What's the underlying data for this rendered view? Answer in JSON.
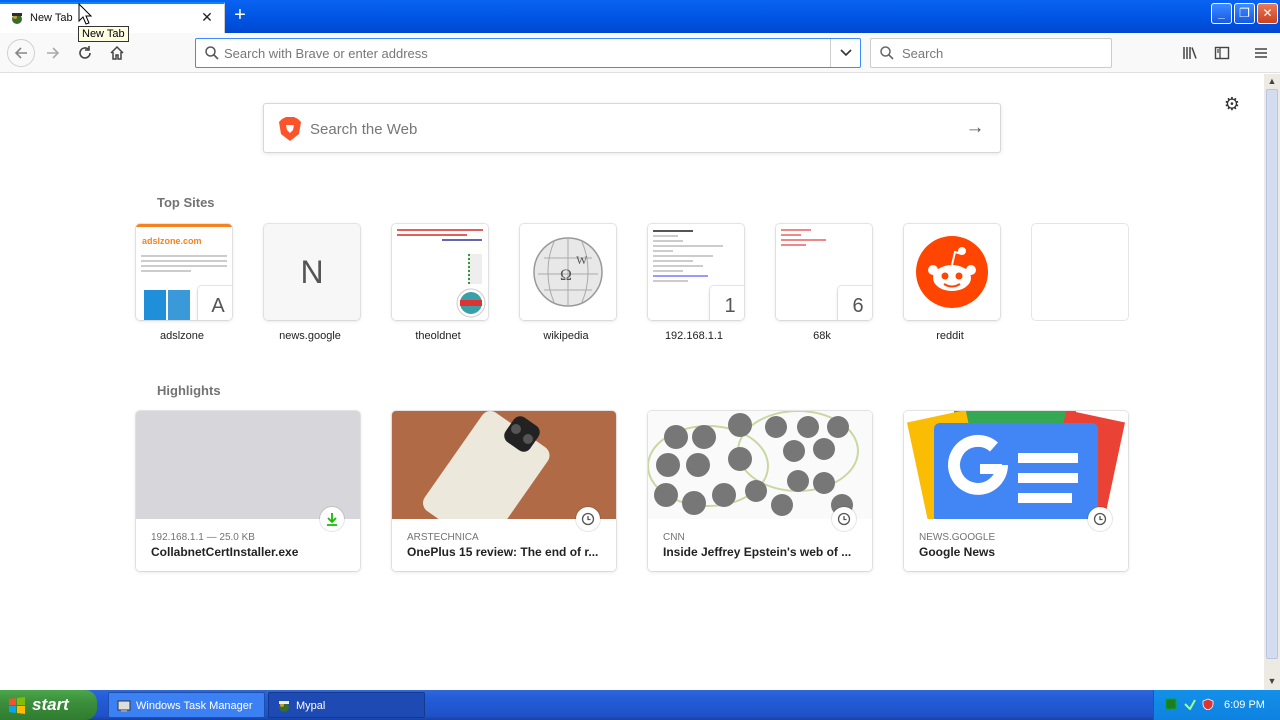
{
  "browser": {
    "tab": {
      "title": "New Tab"
    },
    "tooltip": "New Tab",
    "urlbar": {
      "placeholder": "Search with Brave or enter address"
    },
    "searchbar": {
      "placeholder": "Search"
    }
  },
  "page": {
    "websearch": {
      "placeholder": "Search the Web"
    },
    "top_sites": {
      "title": "Top Sites",
      "items": [
        {
          "label": "adslzone",
          "badge": "A",
          "thumb_text": "adslzone.com"
        },
        {
          "label": "news.google",
          "letter": "N"
        },
        {
          "label": "theoldnet"
        },
        {
          "label": "wikipedia"
        },
        {
          "label": "192.168.1.1",
          "badge": "1"
        },
        {
          "label": "68k",
          "badge": "6"
        },
        {
          "label": "reddit"
        },
        {
          "label": ""
        }
      ]
    },
    "highlights": {
      "title": "Highlights",
      "items": [
        {
          "source": "192.168.1.1 — 25.0 KB",
          "title": "CollabnetCertInstaller.exe"
        },
        {
          "source": "ARSTECHNICA",
          "title": "OnePlus 15 review: The end of r..."
        },
        {
          "source": "CNN",
          "title": "Inside Jeffrey Epstein's web of ..."
        },
        {
          "source": "NEWS.GOOGLE",
          "title": "Google News"
        }
      ]
    }
  },
  "taskbar": {
    "start_label": "start",
    "items": [
      {
        "label": "Windows Task Manager"
      },
      {
        "label": "Mypal"
      }
    ],
    "clock": "6:09 PM"
  },
  "colors": {
    "accent": "#0a84ff",
    "brave": "#fb542b",
    "reddit": "#ff4500",
    "download_green": "#12bc00",
    "xp_blue": "#0054e3",
    "xp_start_green": "#3c8f3c"
  }
}
